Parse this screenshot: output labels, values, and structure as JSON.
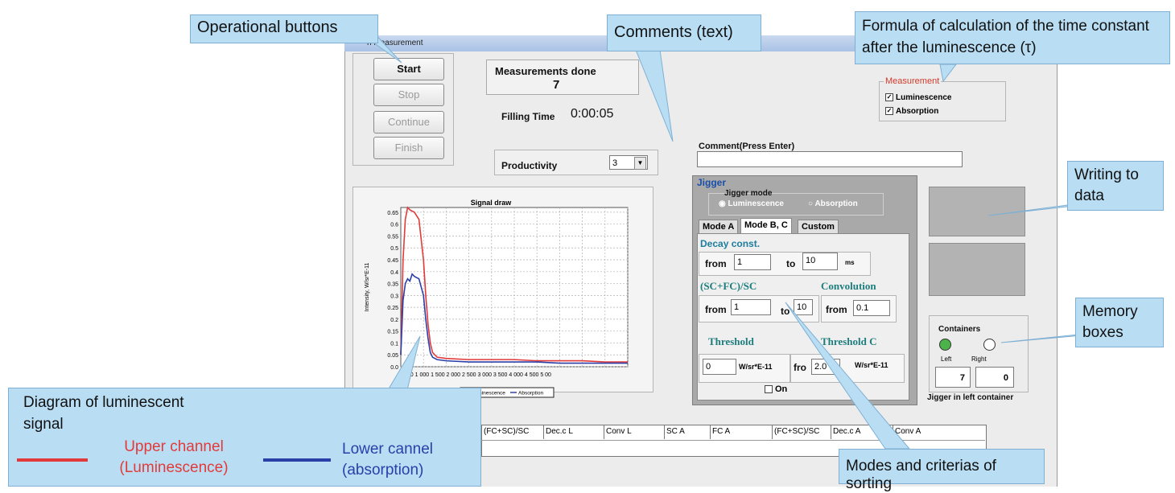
{
  "window": {
    "title_fragment": "n measurement"
  },
  "controls": {
    "start_label": "Start",
    "stop_label": "Stop",
    "continue_label": "Continue",
    "finish_label": "Finish"
  },
  "status": {
    "measurements_label": "Measurements done",
    "measurements_count": "7",
    "filling_time_label": "Filling Time",
    "filling_time_value": "0:00:05",
    "productivity_label": "Productivity",
    "productivity_value": "3"
  },
  "measurement_group": {
    "title": "Measurement",
    "luminescence": "Luminescence",
    "absorption": "Absorption",
    "luminescence_checked": true,
    "absorption_checked": true
  },
  "comment": {
    "label": "Comment(Press Enter)",
    "value": ""
  },
  "jigger": {
    "title": "Jigger",
    "mode_title": "Jigger mode",
    "mode_luminescence": "Luminescence",
    "mode_absorption": "Absorption",
    "tabs": [
      "Mode A",
      "Mode B, C",
      "Custom"
    ],
    "decay_label": "Decay const.",
    "from": "from",
    "to": "to",
    "decay_from": "1",
    "decay_to": "10",
    "decay_unit": "ms",
    "ratio_label": "(SC+FC)/SC",
    "ratio_from": "1",
    "ratio_to": "10",
    "convolution_label": "Convolution",
    "convolution_from": "0.1",
    "threshold_label": "Threshold",
    "threshold_value": "0",
    "threshold_unit": "W/sr*E-11",
    "threshold_c_label": "Threshold C",
    "threshold_c_from": "fro",
    "threshold_c_value": "2.0",
    "threshold_c_unit": "W/sr*E-11",
    "on_label": "On"
  },
  "containers": {
    "title": "Containers",
    "left_label": "Left",
    "right_label": "Right",
    "left_count": "7",
    "right_count": "0",
    "status_text": "Jigger in left container",
    "left_color": "#4cb34a",
    "right_color": "#ffffff"
  },
  "table": {
    "headers": [
      "(FC+SC)/SC",
      "Dec.c L",
      "Conv L",
      "SC A",
      "FC A",
      "(FC+SC)/SC",
      "Dec.c A",
      "Conv A"
    ]
  },
  "chart_data": {
    "type": "line",
    "title": "Signal draw",
    "ylabel": "Intensity, W/sr*E-11",
    "xlabel": "",
    "y_ticks": [
      "0.65",
      "0.6",
      "0.55",
      "0.5",
      "0.45",
      "0.4",
      "0.35",
      "0.3",
      "0.25",
      "0.2",
      "0.15",
      "0.1",
      "0.05",
      "0.0"
    ],
    "x_ticks": [
      "500",
      "1 000",
      "1 500",
      "2 000",
      "2 500",
      "3 000",
      "3 500",
      "4 000",
      "4 500",
      "5 000"
    ],
    "x_tick_text": "500  1 000 1 500 2 000 2 500 3 000 3 500 4 000 4 500 5 00",
    "xlim": [
      0,
      5000
    ],
    "ylim": [
      0,
      0.67
    ],
    "legend_position": "bottom",
    "series": [
      {
        "name": "Luminescence",
        "color": "#e23a3a",
        "x": [
          0,
          50,
          100,
          150,
          200,
          300,
          400,
          500,
          550,
          600,
          650,
          700,
          800,
          1000,
          1500,
          2000,
          2500,
          3000,
          3500,
          4000,
          4500,
          5000
        ],
        "y": [
          0.05,
          0.45,
          0.62,
          0.67,
          0.66,
          0.65,
          0.62,
          0.45,
          0.3,
          0.18,
          0.1,
          0.06,
          0.04,
          0.035,
          0.03,
          0.03,
          0.03,
          0.025,
          0.025,
          0.025,
          0.02,
          0.02
        ]
      },
      {
        "name": "Absorption",
        "color": "#2a3fa8",
        "x": [
          0,
          50,
          100,
          150,
          200,
          250,
          300,
          400,
          500,
          550,
          600,
          650,
          700,
          800,
          1000,
          1500,
          2000,
          2500,
          3000,
          3500,
          4000,
          4500,
          5000
        ],
        "y": [
          0.05,
          0.28,
          0.35,
          0.37,
          0.36,
          0.39,
          0.38,
          0.37,
          0.3,
          0.2,
          0.12,
          0.06,
          0.04,
          0.03,
          0.025,
          0.02,
          0.02,
          0.02,
          0.02,
          0.015,
          0.015,
          0.015,
          0.015
        ]
      }
    ]
  },
  "callouts": {
    "operational_buttons": "Operational buttons",
    "comments": "Comments (text)",
    "formula": "Formula of calculation of the time constant after the luminescence (τ)",
    "writing_to_data": "Writing to data",
    "memory_boxes": "Memory boxes",
    "diagram_title": "Diagram of luminescent signal",
    "upper_channel": "Upper channel (Luminescence)",
    "lower_channel": "Lower cannel (absorption)",
    "modes": "Modes and criterias of sorting",
    "upper_color": "#e23a3a",
    "lower_color": "#2a3fa8"
  }
}
